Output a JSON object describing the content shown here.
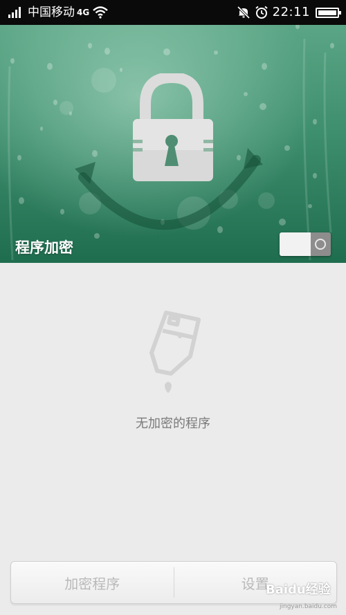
{
  "status_bar": {
    "carrier": "中国移动",
    "network": "4G",
    "time": "22:11",
    "icons": [
      "signal-icon",
      "wifi-icon",
      "mute-icon",
      "alarm-icon",
      "battery-icon"
    ],
    "battery_level": 1.0
  },
  "header": {
    "title": "程序加密",
    "toggle_icon": "switch-toggle",
    "accent_color": "#3e8f6e"
  },
  "empty_state": {
    "icon": "empty-bottle-icon",
    "message": "无加密的程序"
  },
  "bottom_bar": {
    "encrypt_label": "加密程序",
    "settings_label": "设置"
  },
  "watermark": {
    "text": "Baidu经验",
    "url": "jingyan.baidu.com"
  }
}
